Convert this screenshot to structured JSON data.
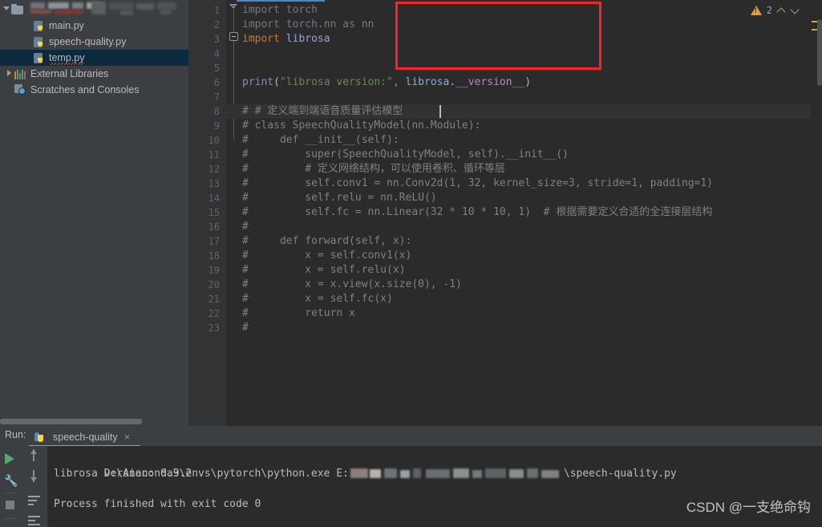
{
  "sidebar": {
    "project_row": {
      "label_redacted": true,
      "icon": "folder-icon",
      "arrow": "expanded"
    },
    "items": [
      {
        "label": "main.py",
        "icon": "python-file-icon",
        "indent": 42,
        "selected": false,
        "squiggle": false
      },
      {
        "label": "speech-quality.py",
        "icon": "python-file-icon",
        "indent": 42,
        "selected": false,
        "squiggle": false
      },
      {
        "label": "temp.py",
        "icon": "python-file-icon",
        "indent": 42,
        "selected": true,
        "squiggle": true
      },
      {
        "label": "External Libraries",
        "icon": "libraries-icon",
        "indent": 20,
        "selected": false,
        "squiggle": false
      },
      {
        "label": "Scratches and Consoles",
        "icon": "scratches-icon",
        "indent": 20,
        "selected": false,
        "squiggle": false
      }
    ]
  },
  "editor": {
    "filename": "temp.py",
    "lines": [
      {
        "n": 1,
        "text": "import torch"
      },
      {
        "n": 2,
        "text": "import torch.nn as nn"
      },
      {
        "n": 3,
        "text": "import librosa"
      },
      {
        "n": 4,
        "text": ""
      },
      {
        "n": 5,
        "text": ""
      },
      {
        "n": 6,
        "text": "print(\"librosa version:\", librosa.__version__)"
      },
      {
        "n": 7,
        "text": ""
      },
      {
        "n": 8,
        "text": "# # 定义端到端语音质量评估模型"
      },
      {
        "n": 9,
        "text": "# class SpeechQualityModel(nn.Module):"
      },
      {
        "n": 10,
        "text": "#     def __init__(self):"
      },
      {
        "n": 11,
        "text": "#         super(SpeechQualityModel, self).__init__()"
      },
      {
        "n": 12,
        "text": "#         # 定义网络结构，可以使用卷积、循环等层"
      },
      {
        "n": 13,
        "text": "#         self.conv1 = nn.Conv2d(1, 32, kernel_size=3, stride=1, padding=1)"
      },
      {
        "n": 14,
        "text": "#         self.relu = nn.ReLU()"
      },
      {
        "n": 15,
        "text": "#         self.fc = nn.Linear(32 * 10 * 10, 1)  # 根据需要定义合适的全连接层结构"
      },
      {
        "n": 16,
        "text": "#"
      },
      {
        "n": 17,
        "text": "#     def forward(self, x):"
      },
      {
        "n": 18,
        "text": "#         x = self.conv1(x)"
      },
      {
        "n": 19,
        "text": "#         x = self.relu(x)"
      },
      {
        "n": 20,
        "text": "#         x = x.view(x.size(0), -1)"
      },
      {
        "n": 21,
        "text": "#         x = self.fc(x)"
      },
      {
        "n": 22,
        "text": "#         return x"
      },
      {
        "n": 23,
        "text": "#"
      }
    ],
    "inspection": {
      "warning_count": "2",
      "warning_icon": "warning-triangle-icon",
      "prev_icon": "chevron-up-icon",
      "next_icon": "chevron-down-icon"
    },
    "annotation": {
      "type": "red-rectangle",
      "color": "#f8232c"
    }
  },
  "run_panel": {
    "label": "Run:",
    "tab": {
      "name": "speech-quality",
      "icon": "python-icon",
      "close": "×"
    },
    "toolbar": [
      {
        "name": "run-button",
        "icon": "play-icon"
      },
      {
        "name": "settings-button",
        "icon": "wrench-icon"
      },
      {
        "name": "stop-button",
        "icon": "stop-icon"
      },
      {
        "name": "up-button",
        "icon": "arrow-up-icon"
      },
      {
        "name": "down-button",
        "icon": "arrow-down-icon"
      },
      {
        "name": "soft-wrap-button",
        "icon": "soft-wrap-icon"
      },
      {
        "name": "scroll-to-end-button",
        "icon": "scroll-to-end-icon"
      }
    ],
    "console": {
      "command_prefix": "D:\\Anaconda3\\envs\\pytorch\\python.exe E:",
      "command_suffix": "\\speech-quality.py",
      "output": "librosa version: 0.9.2",
      "exit": "Process finished with exit code 0"
    }
  },
  "watermark": "CSDN @一支绝命钩",
  "colors": {
    "editor_bg": "#2b2b2b",
    "panel_bg": "#3c3f41",
    "gutter_bg": "#313335",
    "selection_bg": "#0d293e",
    "accent": "#4a88c7",
    "annotation_red": "#f8232c",
    "warning_yellow": "#d9a343",
    "string_green": "#6a8759",
    "keyword_orange": "#cc7832",
    "comment_gray": "#808080"
  }
}
